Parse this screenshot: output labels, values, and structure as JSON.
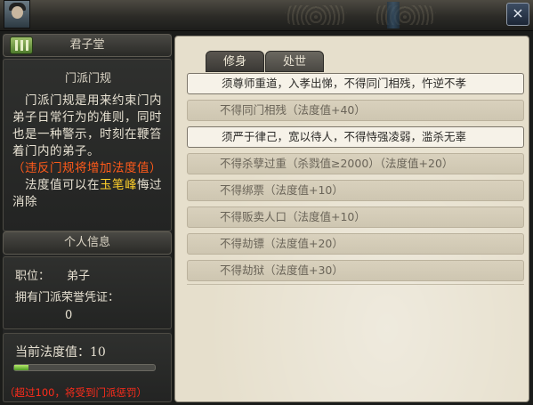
{
  "header": {
    "close_icon": "×"
  },
  "left_panel": {
    "title": "君子堂",
    "rules": {
      "heading": "门派门规",
      "line1": "门派门规是用来约束门内弟子日常行为的准则，同时也是一种警示，时刻在鞭笞着门内的弟子。",
      "warning": "（违反门规将增加法度值）",
      "line2_prefix": "法度值可以在",
      "place": "玉笔峰",
      "line2_suffix": "悔过消除"
    },
    "personal": {
      "heading": "个人信息",
      "position_label": "职位：",
      "position_value": "弟子",
      "honor_label": "拥有门派荣誉凭证：",
      "honor_value": "0"
    },
    "law": {
      "label": "当前法度值：",
      "value": "10",
      "fill_fraction": 0.1,
      "note": "（超过100，将受到门派惩罚）"
    }
  },
  "tabs": [
    {
      "label": "修身"
    },
    {
      "label": "处世"
    }
  ],
  "rules_list": [
    {
      "text": "须尊师重道，入孝出悌，不得同门相残，忤逆不孝",
      "highlight": true
    },
    {
      "text": "不得同门相残（法度值+40）",
      "highlight": false
    },
    {
      "text": "须严于律己，宽以待人，不得恃强凌弱，滥杀无辜",
      "highlight": true
    },
    {
      "text": "不得杀孽过重（杀戮值≥2000）（法度值+20）",
      "highlight": false
    },
    {
      "text": "不得绑票（法度值+10）",
      "highlight": false
    },
    {
      "text": "不得贩卖人口（法度值+10）",
      "highlight": false
    },
    {
      "text": "不得劫镖（法度值+20）",
      "highlight": false
    },
    {
      "text": "不得劫狱（法度值+30）",
      "highlight": false
    }
  ],
  "colors": {
    "warning": "#ff5a1a",
    "place": "#ffd02a",
    "note": "#ff2c1b"
  }
}
